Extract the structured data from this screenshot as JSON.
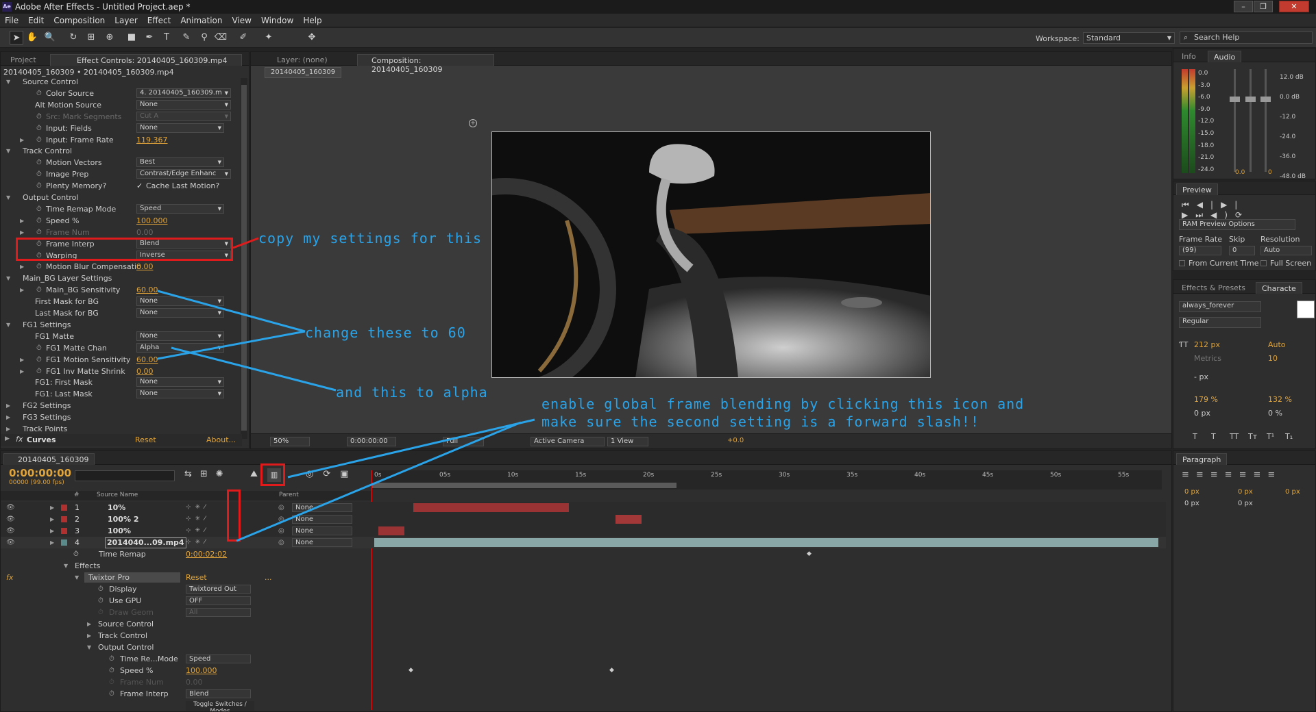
{
  "window": {
    "title": "Adobe After Effects - Untitled Project.aep *",
    "icon_text": "Ae"
  },
  "menu": [
    "File",
    "Edit",
    "Composition",
    "Layer",
    "Effect",
    "Animation",
    "View",
    "Window",
    "Help"
  ],
  "toolbar": {
    "workspace_label": "Workspace:",
    "workspace_value": "Standard",
    "search_placeholder": "Search Help"
  },
  "left_panel": {
    "tab_project": "Project",
    "tab_effect_controls": "Effect Controls: 20140405_160309.mp4",
    "breadcrumb": "20140405_160309 • 20140405_160309.mp4",
    "rows": [
      {
        "label": "Source Control",
        "indent": 1,
        "type": "group"
      },
      {
        "label": "Color Source",
        "indent": 2,
        "value": "4. 20140405_160309.m",
        "type": "dropdown"
      },
      {
        "label": "Alt Motion Source",
        "indent": 2,
        "value": "None",
        "type": "dropdown"
      },
      {
        "label": "Src: Mark Segments",
        "indent": 2,
        "value": "Cut A",
        "type": "dropdown",
        "dim": true
      },
      {
        "label": "Input: Fields",
        "indent": 2,
        "value": "None",
        "type": "dropdown"
      },
      {
        "label": "Input: Frame Rate",
        "indent": 2,
        "value": "119.367",
        "type": "number"
      },
      {
        "label": "Track Control",
        "indent": 1,
        "type": "group"
      },
      {
        "label": "Motion Vectors",
        "indent": 2,
        "value": "Best",
        "type": "dropdown"
      },
      {
        "label": "Image Prep",
        "indent": 2,
        "value": "Contrast/Edge Enhanc",
        "type": "dropdown"
      },
      {
        "label": "Plenty Memory?",
        "indent": 2,
        "value": "Cache Last Motion?",
        "type": "checkbox"
      },
      {
        "label": "Output Control",
        "indent": 1,
        "type": "group"
      },
      {
        "label": "Time Remap Mode",
        "indent": 2,
        "value": "Speed",
        "type": "dropdown"
      },
      {
        "label": "Speed %",
        "indent": 2,
        "value": "100.000",
        "type": "number"
      },
      {
        "label": "Frame Num",
        "indent": 2,
        "value": "0.00",
        "type": "number",
        "dim": true
      },
      {
        "label": "Frame Interp",
        "indent": 2,
        "value": "Blend",
        "type": "dropdown"
      },
      {
        "label": "Warping",
        "indent": 2,
        "value": "Inverse",
        "type": "dropdown"
      },
      {
        "label": "Motion Blur Compensatio",
        "indent": 2,
        "value": "0.00",
        "type": "number"
      },
      {
        "label": "Main_BG Layer Settings",
        "indent": 1,
        "type": "group"
      },
      {
        "label": "Main_BG Sensitivity",
        "indent": 2,
        "value": "60.00",
        "type": "number"
      },
      {
        "label": "First Mask for BG",
        "indent": 2,
        "value": "None",
        "type": "dropdown"
      },
      {
        "label": "Last Mask for BG",
        "indent": 2,
        "value": "None",
        "type": "dropdown"
      },
      {
        "label": "FG1 Settings",
        "indent": 1,
        "type": "group"
      },
      {
        "label": "FG1 Matte",
        "indent": 2,
        "value": "None",
        "type": "dropdown"
      },
      {
        "label": "FG1 Matte Chan",
        "indent": 2,
        "value": "Alpha",
        "type": "dropdown"
      },
      {
        "label": "FG1 Motion Sensitivity",
        "indent": 2,
        "value": "60.00",
        "type": "number"
      },
      {
        "label": "FG1 Inv Matte Shrink",
        "indent": 2,
        "value": "0.00",
        "type": "number"
      },
      {
        "label": "FG1: First Mask",
        "indent": 2,
        "value": "None",
        "type": "dropdown"
      },
      {
        "label": "FG1: Last Mask",
        "indent": 2,
        "value": "None",
        "type": "dropdown"
      },
      {
        "label": "FG2 Settings",
        "indent": 1,
        "type": "group"
      },
      {
        "label": "FG3 Settings",
        "indent": 1,
        "type": "group"
      },
      {
        "label": "Track Points",
        "indent": 1,
        "type": "group"
      }
    ],
    "curves": {
      "label": "Curves",
      "reset": "Reset",
      "about": "About..."
    }
  },
  "viewer": {
    "tab_layer": "Layer: (none)",
    "tab_comp": "Composition: 20140405_160309",
    "comp_chip": "20140405_160309",
    "zoom": "50%",
    "timecode": "0:00:00:00",
    "quality": "Full",
    "camera": "Active Camera",
    "views": "1 View",
    "exposure": "+0.0"
  },
  "info_panel": {
    "tab_info": "Info",
    "tab_audio": "Audio",
    "db_left": [
      "0.0",
      "-3.0",
      "-6.0",
      "-9.0",
      "-12.0",
      "-15.0",
      "-18.0",
      "-21.0",
      "-24.0"
    ],
    "db_right": [
      "12.0 dB",
      "0.0 dB",
      "-12.0",
      "-24.0",
      "-36.0",
      "-48.0 dB"
    ],
    "slider_vals": [
      "0.0",
      "0"
    ]
  },
  "preview_panel": {
    "tab": "Preview",
    "ram_options": "RAM Preview Options",
    "frame_rate_label": "Frame Rate",
    "skip_label": "Skip",
    "resolution_label": "Resolution",
    "frame_rate": "(99)",
    "skip": "0",
    "resolution": "Auto",
    "from_current": "From Current Time",
    "full_screen": "Full Screen"
  },
  "character_panel": {
    "tab_effects": "Effects & Presets",
    "tab_character": "Characte",
    "font": "always_forever",
    "style": "Regular",
    "font_size": "212 px",
    "leading": "Auto",
    "kerning": "Metrics",
    "tracking": "10",
    "stroke": "- px",
    "vscale": "179 %",
    "hscale": "132 %",
    "baseline": "0 px",
    "tsume": "0 %",
    "styles": [
      "T",
      "T",
      "TT",
      "Tт",
      "T¹",
      "T₁"
    ]
  },
  "paragraph_panel": {
    "tab": "Paragraph",
    "vals": [
      "0 px",
      "0 px",
      "0 px",
      "0 px",
      "0 px"
    ]
  },
  "timeline": {
    "tab": "20140405_160309",
    "timecode": "0:00:00:00",
    "frames": "00000 (99.00 fps)",
    "columns": {
      "num": "#",
      "source": "Source Name",
      "parent": "Parent"
    },
    "ruler": [
      "0s",
      "05s",
      "10s",
      "15s",
      "20s",
      "25s",
      "30s",
      "35s",
      "40s",
      "45s",
      "50s",
      "55s"
    ],
    "layers": [
      {
        "num": "1",
        "name": "10%",
        "parent": "None",
        "color": "#b03030"
      },
      {
        "num": "2",
        "name": "100% 2",
        "parent": "None",
        "color": "#b03030"
      },
      {
        "num": "3",
        "name": "100%",
        "parent": "None",
        "color": "#b03030"
      },
      {
        "num": "4",
        "name": "2014040...09.mp4",
        "parent": "None",
        "color": "#5a8a8a"
      }
    ],
    "time_remap": {
      "label": "Time Remap",
      "value": "0:00:02:02"
    },
    "effects_label": "Effects",
    "twixtor": {
      "label": "Twixtor Pro",
      "reset": "Reset",
      "dots": "..."
    },
    "props": [
      {
        "label": "Display",
        "value": "Twixtored Out"
      },
      {
        "label": "Use GPU",
        "value": "OFF"
      },
      {
        "label": "Draw Geom",
        "value": "All",
        "dim": true
      },
      {
        "label": "Source Control",
        "group": true
      },
      {
        "label": "Track Control",
        "group": true
      },
      {
        "label": "Output Control",
        "group": true
      },
      {
        "label": "Time Re...Mode",
        "value": "Speed"
      },
      {
        "label": "Speed %",
        "value": "100.000",
        "number": true
      },
      {
        "label": "Frame Num",
        "value": "0.00",
        "dim": true,
        "number": true
      },
      {
        "label": "Frame Interp",
        "value": "Blend"
      }
    ],
    "toggle_label": "Toggle Switches / Modes"
  },
  "annotations": {
    "copy": "copy my settings for this",
    "change": "change these to 60",
    "alpha": "and this to alpha",
    "enable1": "enable global frame blending by clicking this icon and",
    "enable2": "make sure the second setting is a forward slash!!"
  },
  "colors": {
    "accent_orange": "#e0a43a",
    "annotation_blue": "#2aa3e8",
    "annotation_red": "#e01b1b"
  }
}
